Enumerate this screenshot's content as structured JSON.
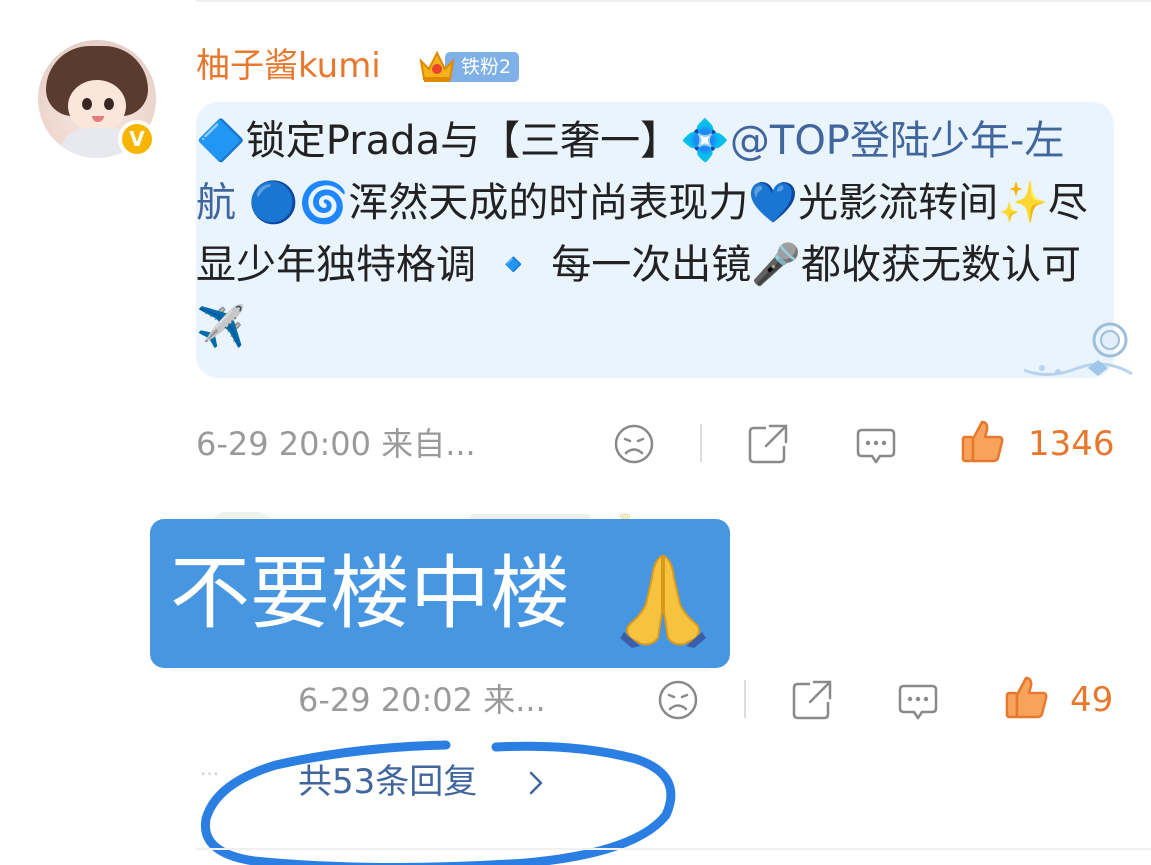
{
  "comment": {
    "username": "柚子酱kumi",
    "fan_badge": "铁粉2",
    "text": {
      "p1": "🔷锁定Prada与【三奢一】💠",
      "mention": "@TOP登陆少年-左航",
      "p2": " 🔵🌀浑然天成的时尚表现力💙光影流转间✨尽显少年独特格调 🔹 每一次出镜🎤都收获无数认可✈️"
    },
    "time": "6-29 20:00 来自...",
    "like_count": "1346"
  },
  "overlay": {
    "text": "不要楼中楼",
    "emoji": "🙏"
  },
  "reply": {
    "time": "6-29 20:02 来...",
    "like_count": "49",
    "more_label": "共53条回复"
  },
  "icons": [
    "verified-icon",
    "crown-icon",
    "sad-face-icon",
    "share-icon",
    "comment-icon",
    "like-icon",
    "chevron-right-icon",
    "pray-icon"
  ],
  "colors": {
    "username": "#e8782e",
    "like": "#e8782e",
    "link": "#41669e",
    "bubble_bg": "#eaf4fd",
    "overlay_bg": "#4796e2",
    "meta": "#9a9a9a",
    "scribble": "#2b7fe3"
  }
}
